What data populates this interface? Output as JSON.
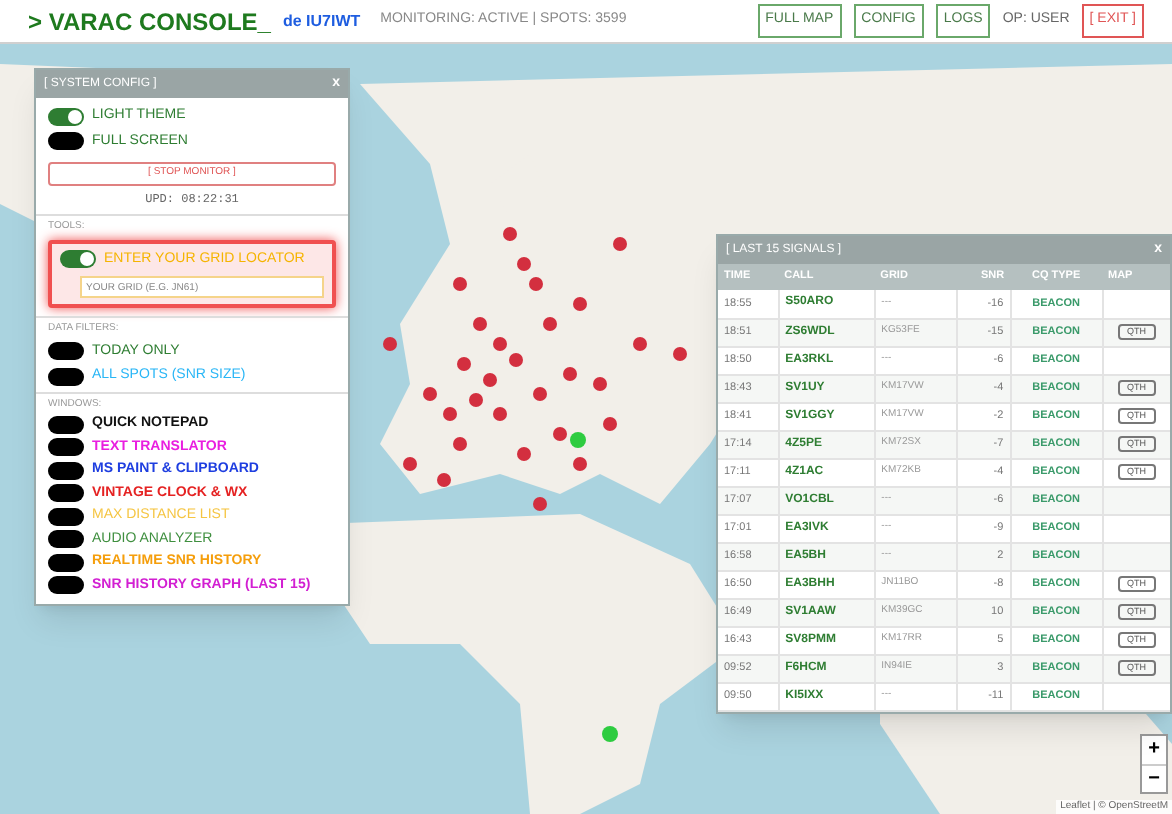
{
  "header": {
    "prompt": ">",
    "title": "VARAC CONSOLE_",
    "station": "de IU7IWT",
    "status": "MONITORING: ACTIVE | SPOTS: 3599",
    "buttons": [
      {
        "label": "FULL MAP",
        "kind": "normal"
      },
      {
        "label": "CONFIG",
        "kind": "normal"
      },
      {
        "label": "LOGS",
        "kind": "normal"
      }
    ],
    "operator": "OP: USER",
    "exit": "[ EXIT ]"
  },
  "config": {
    "title": "[ SYSTEM CONFIG ]",
    "close": "x",
    "toggles": [
      {
        "label": "LIGHT THEME",
        "on": true
      },
      {
        "label": "FULL SCREEN",
        "on": false
      }
    ],
    "stop_button": "[ STOP MONITOR ]",
    "updated": "UPD: 08:22:31",
    "tools_label": "TOOLS:",
    "grid_toggle": {
      "label": "ENTER YOUR GRID LOCATOR",
      "on": true
    },
    "grid_placeholder": "YOUR GRID (E.G. JN61)",
    "filters_label": "DATA FILTERS:",
    "filters": [
      {
        "label": "TODAY ONLY",
        "on": false,
        "color": "#2e7d32"
      },
      {
        "label": "ALL SPOTS (SNR SIZE)",
        "on": false,
        "color": "#29b6f6"
      }
    ],
    "windows_label": "WINDOWS:",
    "windows": [
      {
        "label": "QUICK NOTEPAD",
        "on": false,
        "bold": true,
        "color": "#111111"
      },
      {
        "label": "TEXT TRANSLATOR",
        "on": false,
        "bold": true,
        "color": "#e91ee0"
      },
      {
        "label": "MS PAINT & CLIPBOARD",
        "on": false,
        "bold": true,
        "color": "#1e3ee0"
      },
      {
        "label": "VINTAGE CLOCK & WX",
        "on": false,
        "bold": true,
        "color": "#e52222"
      },
      {
        "label": "MAX DISTANCE LIST",
        "on": false,
        "bold": false,
        "color": "#f5c542"
      },
      {
        "label": "AUDIO ANALYZER",
        "on": false,
        "bold": false,
        "color": "#3f8f3f"
      },
      {
        "label": "REALTIME SNR HISTORY",
        "on": false,
        "bold": true,
        "color": "#f59e0b"
      },
      {
        "label": "SNR HISTORY GRAPH (LAST 15)",
        "on": false,
        "bold": true,
        "color": "#d21fd2"
      }
    ]
  },
  "signals": {
    "title": "[ LAST 15 SIGNALS ]",
    "close": "x",
    "columns": [
      "TIME",
      "CALL",
      "GRID",
      "SNR",
      "CQ TYPE",
      "MAP"
    ],
    "rows": [
      {
        "time": "18:55",
        "call": "S50ARO",
        "grid": "---",
        "snr": "-16",
        "type": "BEACON"
      },
      {
        "time": "18:51",
        "call": "ZS6WDL",
        "grid": "KG53FE",
        "snr": "-15",
        "type": "BEACON",
        "map": "QTH"
      },
      {
        "time": "18:50",
        "call": "EA3RKL",
        "grid": "---",
        "snr": "-6",
        "type": "BEACON"
      },
      {
        "time": "18:43",
        "call": "SV1UY",
        "grid": "KM17VW",
        "snr": "-4",
        "type": "BEACON",
        "map": "QTH"
      },
      {
        "time": "18:41",
        "call": "SV1GGY",
        "grid": "KM17VW",
        "snr": "-2",
        "type": "BEACON",
        "map": "QTH"
      },
      {
        "time": "17:14",
        "call": "4Z5PE",
        "grid": "KM72SX",
        "snr": "-7",
        "type": "BEACON",
        "map": "QTH"
      },
      {
        "time": "17:11",
        "call": "4Z1AC",
        "grid": "KM72KB",
        "snr": "-4",
        "type": "BEACON",
        "map": "QTH"
      },
      {
        "time": "17:07",
        "call": "VO1CBL",
        "grid": "---",
        "snr": "-6",
        "type": "BEACON"
      },
      {
        "time": "17:01",
        "call": "EA3IVK",
        "grid": "---",
        "snr": "-9",
        "type": "BEACON"
      },
      {
        "time": "16:58",
        "call": "EA5BH",
        "grid": "---",
        "snr": "2",
        "type": "BEACON"
      },
      {
        "time": "16:50",
        "call": "EA3BHH",
        "grid": "JN11BO",
        "snr": "-8",
        "type": "BEACON",
        "map": "QTH"
      },
      {
        "time": "16:49",
        "call": "SV1AAW",
        "grid": "KM39GC",
        "snr": "10",
        "type": "BEACON",
        "map": "QTH"
      },
      {
        "time": "16:43",
        "call": "SV8PMM",
        "grid": "KM17RR",
        "snr": "5",
        "type": "BEACON",
        "map": "QTH"
      },
      {
        "time": "09:52",
        "call": "F6HCM",
        "grid": "IN94IE",
        "snr": "3",
        "type": "BEACON",
        "map": "QTH"
      },
      {
        "time": "09:50",
        "call": "KI5IXX",
        "grid": "---",
        "snr": "-11",
        "type": "BEACON"
      }
    ]
  },
  "map": {
    "zoom_in": "+",
    "zoom_out": "−",
    "attribution": "Leaflet | © OpenStreetM"
  }
}
